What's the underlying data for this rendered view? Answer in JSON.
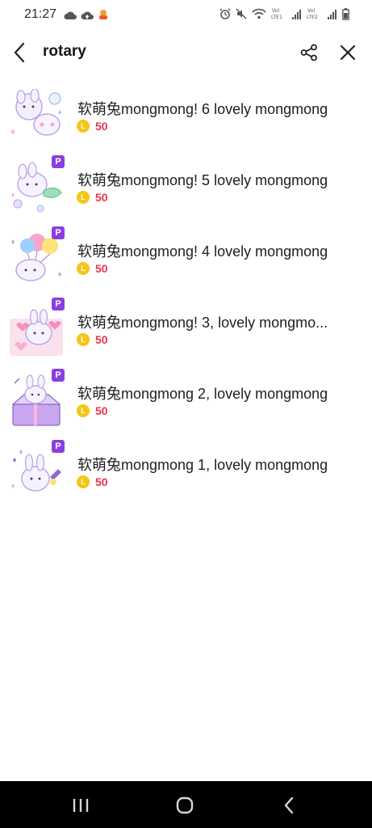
{
  "status_bar": {
    "time": "21:27",
    "left_icons": [
      "cloud-icon",
      "cloud-upload-icon",
      "app-notification-icon"
    ],
    "right_icons": [
      "alarm-icon",
      "mute-icon",
      "wifi-icon",
      "volte-lte1-icon",
      "signal-icon",
      "volte-lte2-icon",
      "signal-icon",
      "battery-icon"
    ],
    "lte1_label": "Vo)\nLTE1",
    "lte2_label": "Vo)\nLTE2"
  },
  "header": {
    "title": "rotary",
    "back_icon": "chevron-left-icon",
    "share_icon": "share-icon",
    "close_icon": "close-icon"
  },
  "colors": {
    "price": "#e8364f",
    "coin": "#f5c518",
    "premium_badge": "#8a3fe0",
    "nav_bar": "#000000"
  },
  "items": [
    {
      "title": "软萌兔mongmong! 6 lovely mongmong",
      "price": "50",
      "coin_letter": "L",
      "premium": false,
      "badge": ""
    },
    {
      "title": "软萌兔mongmong! 5 lovely mongmong",
      "price": "50",
      "coin_letter": "L",
      "premium": true,
      "badge": "P"
    },
    {
      "title": "软萌兔mongmong! 4 lovely mongmong",
      "price": "50",
      "coin_letter": "L",
      "premium": true,
      "badge": "P"
    },
    {
      "title": "软萌兔mongmong! 3, lovely mongmo...",
      "price": "50",
      "coin_letter": "L",
      "premium": true,
      "badge": "P"
    },
    {
      "title": "软萌兔mongmong 2, lovely mongmong",
      "price": "50",
      "coin_letter": "L",
      "premium": true,
      "badge": "P"
    },
    {
      "title": "软萌兔mongmong 1, lovely mongmong",
      "price": "50",
      "coin_letter": "L",
      "premium": true,
      "badge": "P"
    }
  ],
  "nav": {
    "recents_icon": "recent-apps-icon",
    "home_icon": "home-icon",
    "back_icon": "nav-back-icon"
  }
}
